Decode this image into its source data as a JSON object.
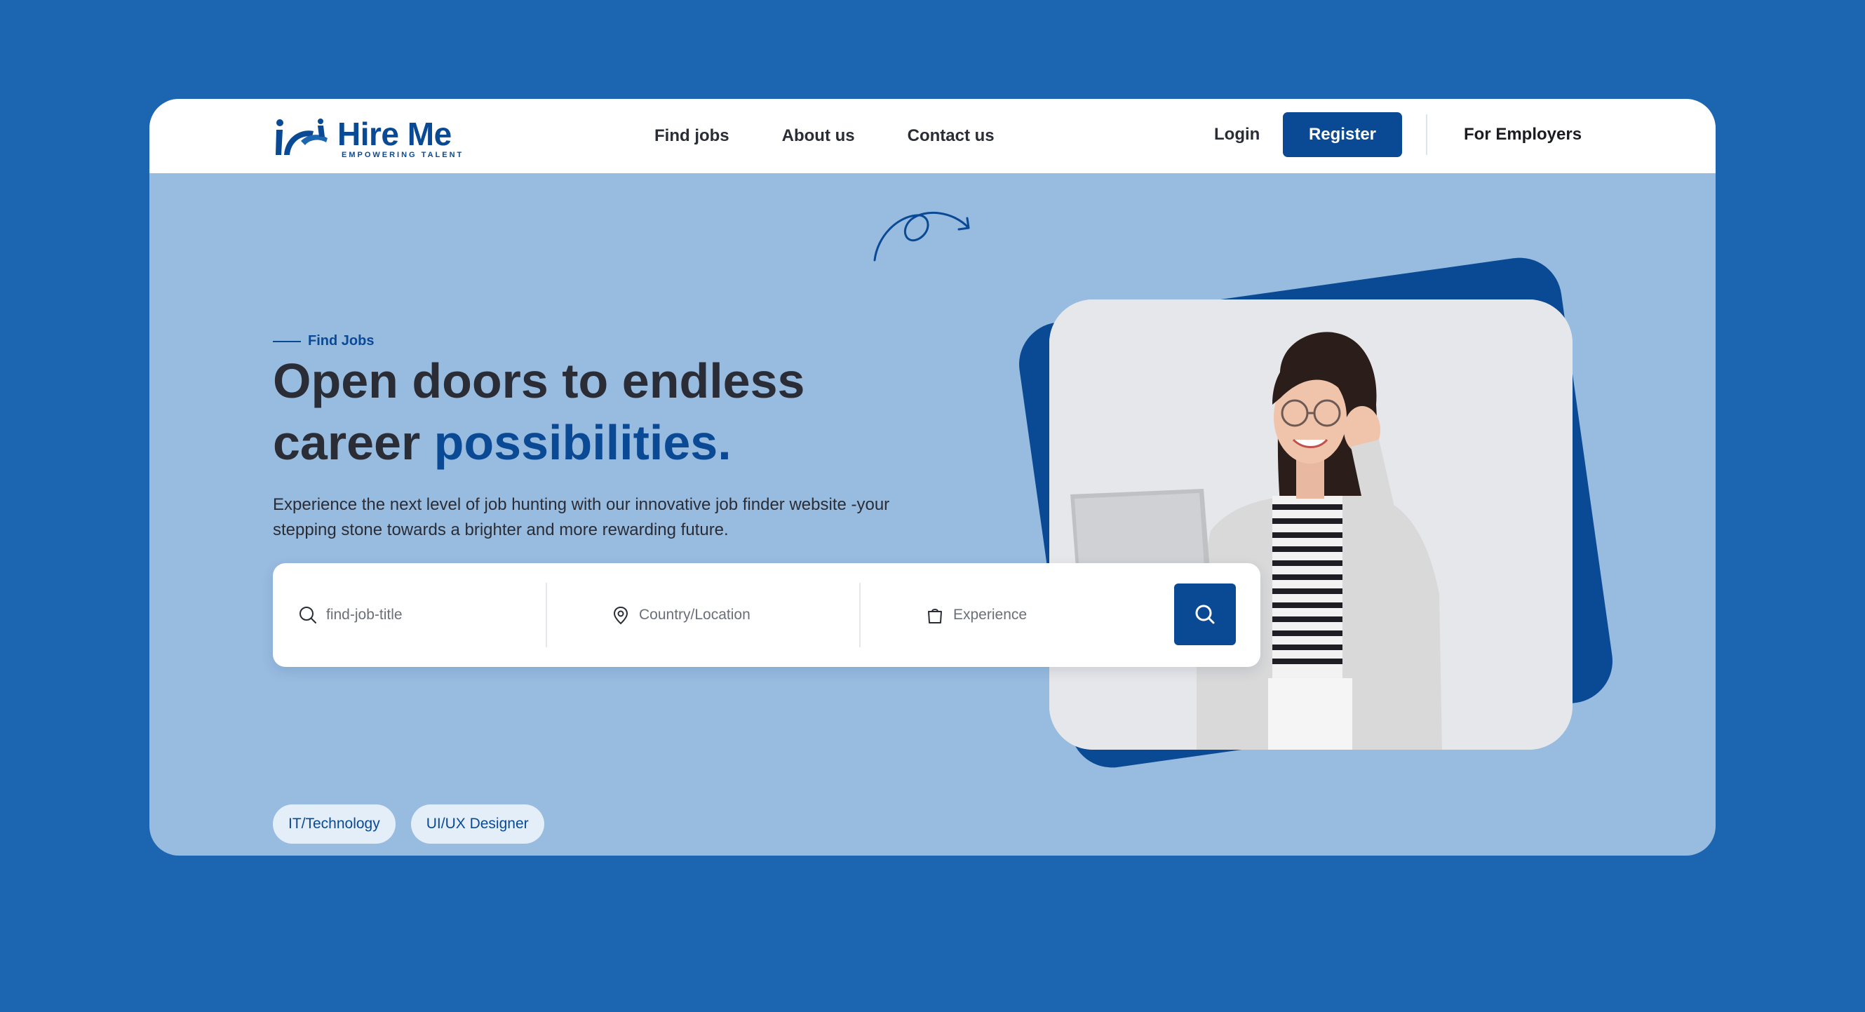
{
  "brand": {
    "name": "Hire Me",
    "tagline": "EMPOWERING TALENT",
    "primary_color": "#0a4a94",
    "background_color": "#1c65b1",
    "hero_color": "#98bbe0"
  },
  "nav": {
    "links": [
      "Find jobs",
      "About us",
      "Contact us"
    ],
    "login_label": "Login",
    "register_label": "Register",
    "employers_label": "For Employers"
  },
  "hero": {
    "eyebrow": "Find Jobs",
    "headline_part1": "Open doors to endless career ",
    "headline_accent": "possibilities.",
    "subtext": "Experience the next level of job hunting with our innovative job finder website -your stepping stone towards a brighter and more rewarding future."
  },
  "search": {
    "job_title_placeholder": "find-job-title",
    "location_placeholder": "Country/Location",
    "experience_placeholder": "Experience",
    "icons": [
      "search-icon",
      "location-pin-icon",
      "briefcase-icon",
      "search-icon"
    ]
  },
  "tags": [
    "IT/Technology",
    "UI/UX Designer"
  ]
}
